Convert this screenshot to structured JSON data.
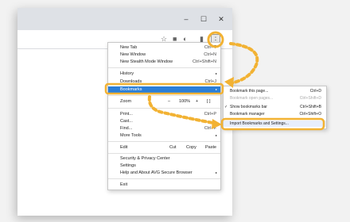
{
  "window": {
    "controls": {
      "minimize": "–",
      "maximize": "☐",
      "close": "✕"
    },
    "toolbar_icons": {
      "star": "☆",
      "ext1": "■",
      "ext2": "◐",
      "ext3": "▮"
    },
    "menu_button": "⋮"
  },
  "menu": {
    "items": {
      "new_tab": {
        "label": "New Tab",
        "shortcut": "Ctrl+T"
      },
      "new_window": {
        "label": "New Window",
        "shortcut": "Ctrl+N"
      },
      "stealth": {
        "label": "New Stealth Mode Window",
        "shortcut": "Ctrl+Shift+N"
      },
      "history": {
        "label": "History",
        "arrow": "▸"
      },
      "downloads": {
        "label": "Downloads",
        "shortcut": "Ctrl+J"
      },
      "bookmarks": {
        "label": "Bookmarks",
        "arrow": "▸"
      },
      "zoom": {
        "label": "Zoom",
        "minus": "–",
        "value": "100%",
        "plus": "+",
        "fullscreen": "[ ]"
      },
      "print": {
        "label": "Print...",
        "shortcut": "Ctrl+P"
      },
      "cast": {
        "label": "Cast..."
      },
      "find": {
        "label": "Find...",
        "shortcut": "Ctrl+F"
      },
      "more_tools": {
        "label": "More Tools",
        "arrow": "▸"
      },
      "edit": {
        "label": "Edit",
        "cut": "Cut",
        "copy": "Copy",
        "paste": "Paste"
      },
      "security": {
        "label": "Security & Privacy Center"
      },
      "settings": {
        "label": "Settings"
      },
      "help": {
        "label": "Help and About AVG Secure Browser",
        "arrow": "▸"
      },
      "exit": {
        "label": "Exit"
      }
    }
  },
  "submenu": {
    "bookmark_page": {
      "label": "Bookmark this page...",
      "shortcut": "Ctrl+D"
    },
    "bookmark_open": {
      "label": "Bookmark open pages...",
      "shortcut": "Ctrl+Shift+D"
    },
    "show_bar": {
      "check": "✓",
      "label": "Show bookmarks bar",
      "shortcut": "Ctrl+Shift+B"
    },
    "manager": {
      "label": "Bookmark manager",
      "shortcut": "Ctrl+Shift+O"
    },
    "import": {
      "label": "Import Bookmarks and Settings..."
    }
  },
  "colors": {
    "highlight": "#2b7fd9",
    "annotation": "#f2b233"
  }
}
